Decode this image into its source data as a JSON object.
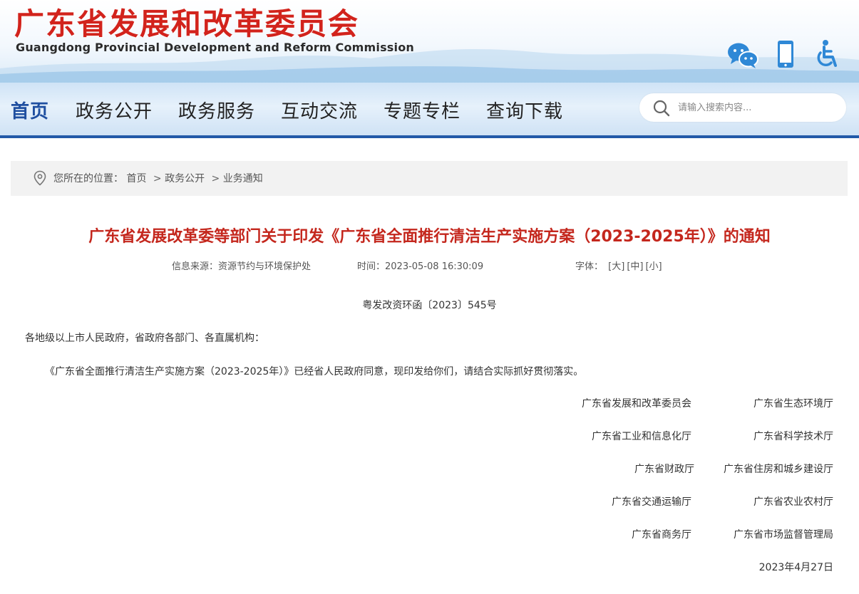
{
  "header": {
    "title": "广东省发展和改革委员会",
    "subtitle": "Guangdong Provincial Development and Reform Commission",
    "icons": [
      "wechat-icon",
      "mobile-icon",
      "accessibility-icon"
    ],
    "colors": {
      "title": "#d2231c",
      "accent": "#2159a8",
      "icon": "#2f88d6"
    }
  },
  "nav": {
    "items": [
      {
        "label": "首页",
        "active": true
      },
      {
        "label": "政务公开",
        "active": false
      },
      {
        "label": "政务服务",
        "active": false
      },
      {
        "label": "互动交流",
        "active": false
      },
      {
        "label": "专题专栏",
        "active": false
      },
      {
        "label": "查询下载",
        "active": false
      }
    ],
    "search_placeholder": "请输入搜索内容..."
  },
  "breadcrumb": {
    "prefix": "您所在的位置：",
    "items": [
      "首页",
      "政务公开",
      "业务通知"
    ],
    "separator": ">"
  },
  "article": {
    "title": "广东省发展改革委等部门关于印发《广东省全面推行清洁生产实施方案（2023-2025年）》的通知",
    "source_label": "信息来源：",
    "source": "资源节约与环境保护处",
    "time_label": "时间：",
    "time": "2023-05-08 16:30:09",
    "font_label": "字体：",
    "font_sizes": [
      "[大]",
      "[中]",
      "[小]"
    ],
    "doc_number": "粤发改资环函〔2023〕545号",
    "salutation": "各地级以上市人民政府，省政府各部门、各直属机构：",
    "body": "《广东省全面推行清洁生产实施方案（2023-2025年）》已经省人民政府同意，现印发给你们，请结合实际抓好贯彻落实。",
    "signers": [
      [
        "广东省发展和改革委员会",
        "广东省生态环境厅"
      ],
      [
        "广东省工业和信息化厅",
        "广东省科学技术厅"
      ],
      [
        "广东省财政厅",
        "广东省住房和城乡建设厅"
      ],
      [
        "广东省交通运输厅",
        "广东省农业农村厅"
      ],
      [
        "广东省商务厅",
        "广东省市场监督管理局"
      ]
    ],
    "date": "2023年4月27日"
  }
}
